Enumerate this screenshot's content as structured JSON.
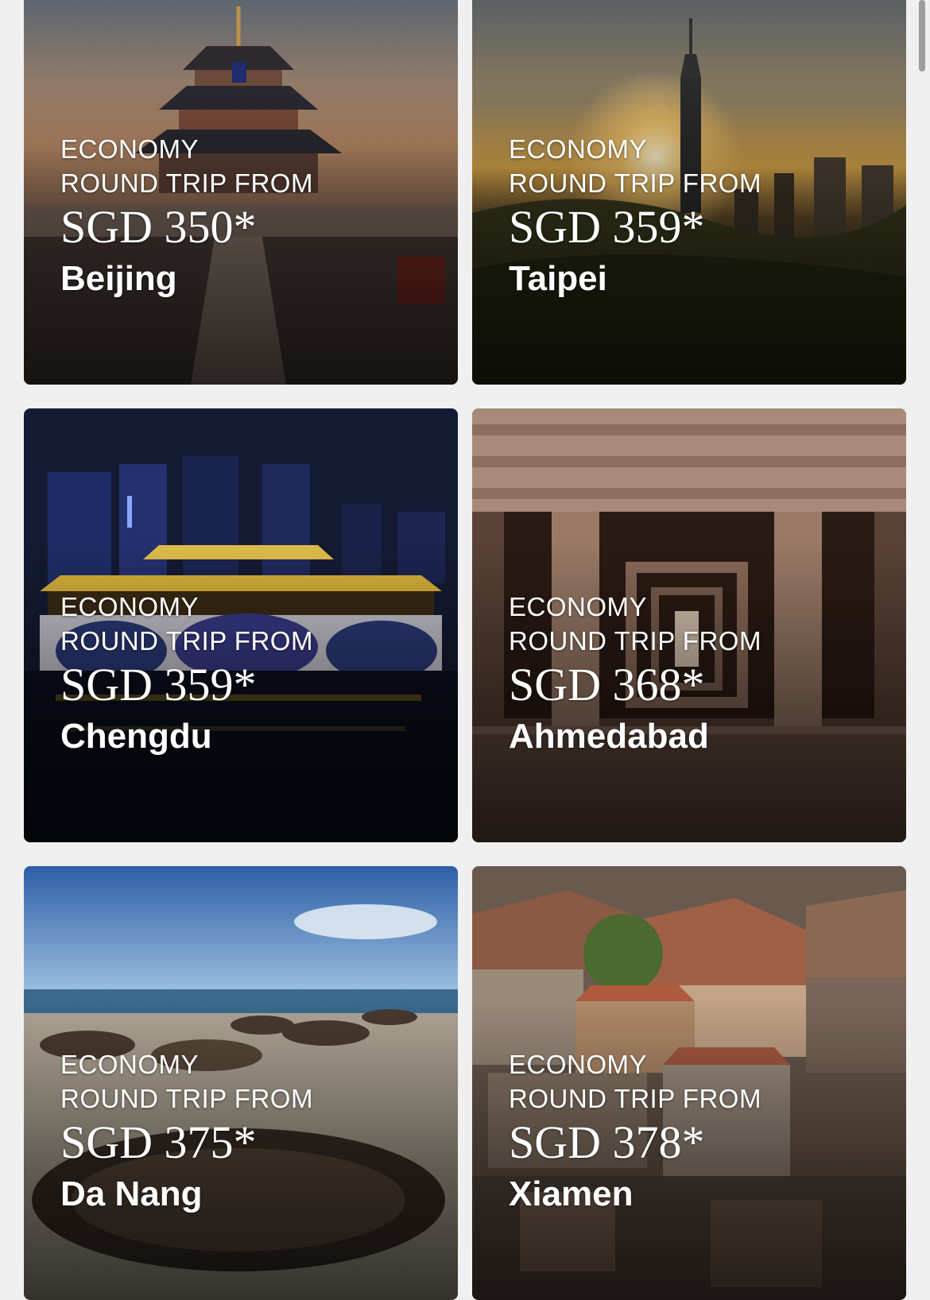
{
  "cards": [
    {
      "cabin": "ECONOMY",
      "trip": "ROUND TRIP FROM",
      "price": "SGD 350*",
      "city": "Beijing"
    },
    {
      "cabin": "ECONOMY",
      "trip": "ROUND TRIP FROM",
      "price": "SGD 359*",
      "city": "Taipei"
    },
    {
      "cabin": "ECONOMY",
      "trip": "ROUND TRIP FROM",
      "price": "SGD 359*",
      "city": "Chengdu"
    },
    {
      "cabin": "ECONOMY",
      "trip": "ROUND TRIP FROM",
      "price": "SGD 368*",
      "city": "Ahmedabad"
    },
    {
      "cabin": "ECONOMY",
      "trip": "ROUND TRIP FROM",
      "price": "SGD 375*",
      "city": "Da Nang"
    },
    {
      "cabin": "ECONOMY",
      "trip": "ROUND TRIP FROM",
      "price": "SGD 378*",
      "city": "Xiamen"
    }
  ]
}
